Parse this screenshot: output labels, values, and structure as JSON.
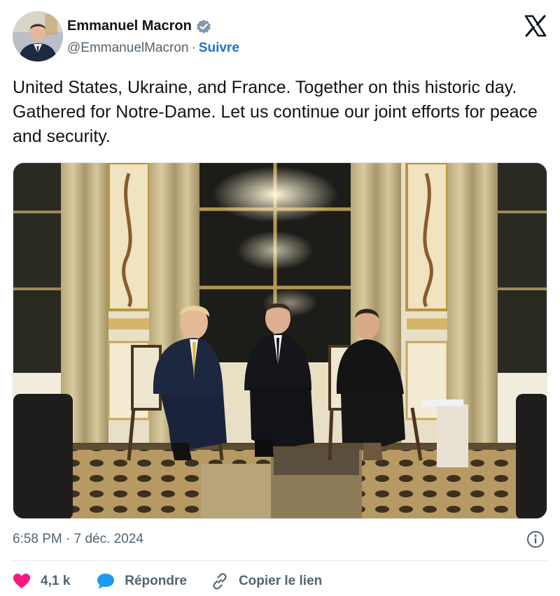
{
  "author": {
    "display_name": "Emmanuel Macron",
    "handle": "@EmmanuelMacron",
    "separator": "·",
    "follow_label": "Suivre",
    "verified_badge": "verified-badge-icon",
    "avatar": "avatar-photo"
  },
  "tweet": {
    "text": "United States, Ukraine, and France. Together on this historic day. Gathered for Notre-Dame. Let us continue our joint efforts for peace and security.",
    "media": "photo-three-leaders-seated-in-gilded-salon"
  },
  "meta": {
    "timestamp": "6:58 PM · 7 déc. 2024",
    "info_icon": "info-icon"
  },
  "actions": {
    "like_count": "4,1 k",
    "reply_label": "Répondre",
    "copy_link_label": "Copier le lien"
  },
  "colors": {
    "like": "#f91880",
    "reply": "#1d9bf0",
    "link": "#1d75c9",
    "secondary_text": "#536471",
    "verified": "#829aab"
  },
  "brand": {
    "logo": "x-logo"
  }
}
